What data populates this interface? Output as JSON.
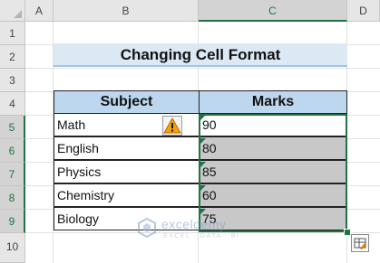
{
  "columns": [
    "A",
    "B",
    "C",
    "D"
  ],
  "rows": [
    "1",
    "2",
    "3",
    "4",
    "5",
    "6",
    "7",
    "8",
    "9",
    "10"
  ],
  "title": "Changing Cell Format",
  "table": {
    "headers": [
      "Subject",
      "Marks"
    ],
    "rows": [
      {
        "subject": "Math",
        "marks": "90"
      },
      {
        "subject": "English",
        "marks": "80"
      },
      {
        "subject": "Physics",
        "marks": "85"
      },
      {
        "subject": "Chemistry",
        "marks": "60"
      },
      {
        "subject": "Biology",
        "marks": "75"
      }
    ]
  },
  "watermark": {
    "name": "exceldemy",
    "sub": "EXCEL · DATA · BI"
  },
  "colors": {
    "accent": "#217346",
    "header_fill": "#bdd7ee",
    "title_fill": "#dce9f5",
    "selected_cells": "#c8c8c8",
    "warning": "#f0a30a"
  },
  "icons": [
    "warning-icon",
    "quick-analysis-icon"
  ]
}
